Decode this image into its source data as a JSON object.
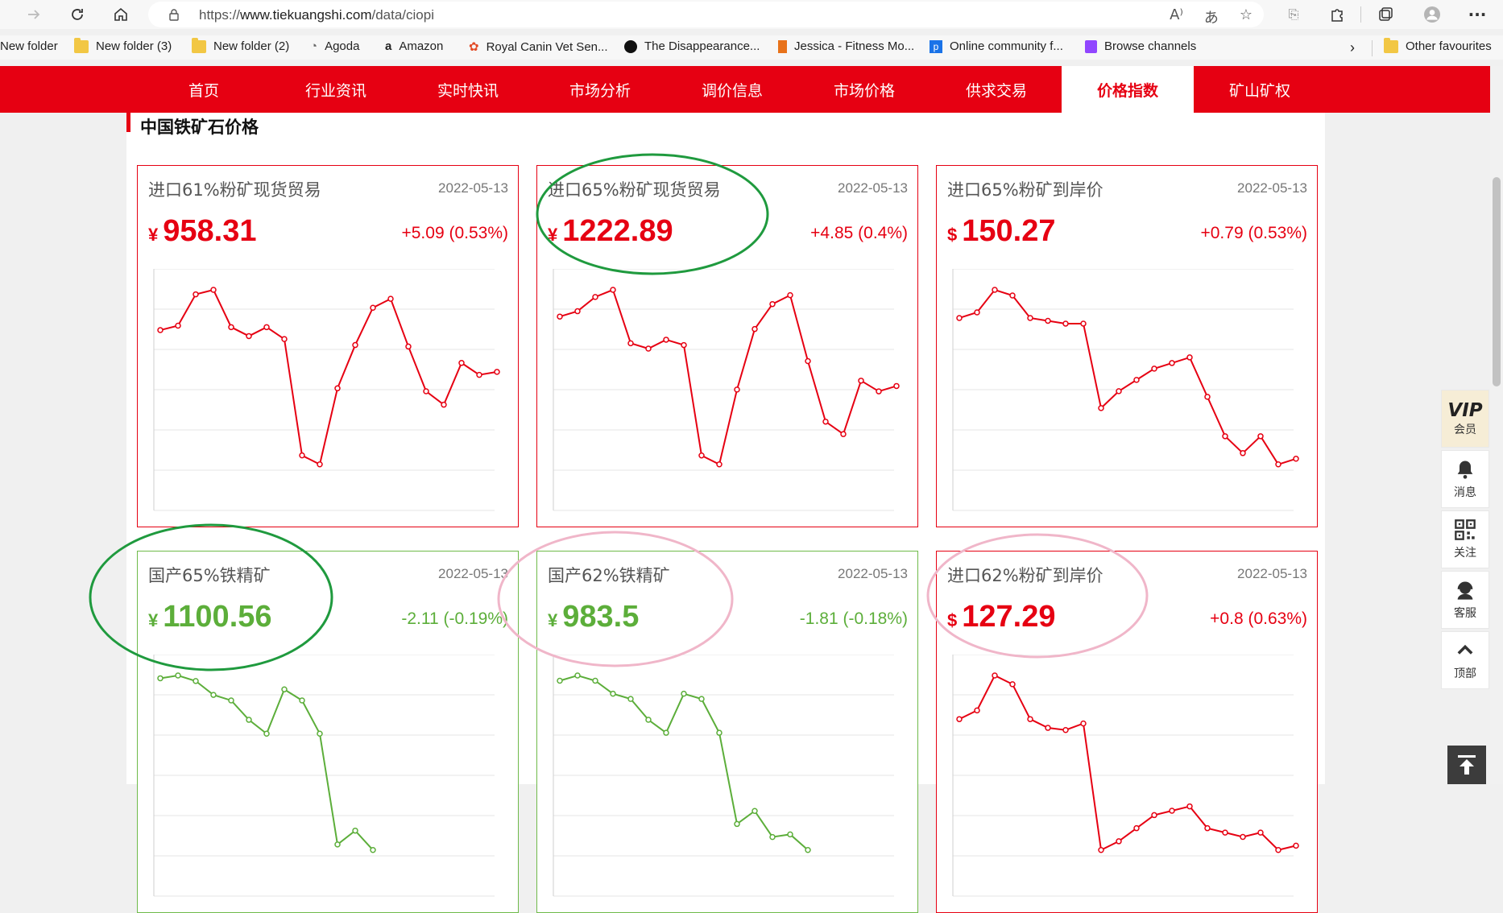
{
  "browser": {
    "url_prefix": "https://",
    "url_host": "www.tiekuangshi.com",
    "url_path": "/data/ciopi",
    "bookmarks": [
      {
        "label": "New folder",
        "icon": "folder-icon"
      },
      {
        "label": "New folder (3)",
        "icon": "folder-icon"
      },
      {
        "label": "New folder (2)",
        "icon": "folder-icon"
      },
      {
        "label": "Agoda",
        "icon": "agoda-icon"
      },
      {
        "label": "Amazon",
        "icon": "amazon-icon"
      },
      {
        "label": "Royal Canin Vet Sen...",
        "icon": "royal-canin-icon"
      },
      {
        "label": "The Disappearance...",
        "icon": "netflix-icon"
      },
      {
        "label": "Jessica - Fitness Mo...",
        "icon": "bookmark-icon"
      },
      {
        "label": "Online community f...",
        "icon": "community-icon"
      },
      {
        "label": "Browse channels",
        "icon": "twitch-icon"
      }
    ],
    "other_favourites": "Other favourites"
  },
  "nav": {
    "items": [
      "首页",
      "行业资讯",
      "实时快讯",
      "市场分析",
      "调价信息",
      "市场价格",
      "供求交易",
      "价格指数",
      "矿山矿权"
    ],
    "active_index": 7
  },
  "section_title": "中国铁矿石价格",
  "cards": [
    {
      "name": "进口61%粉矿现货贸易",
      "date": "2022-05-13",
      "currency": "¥",
      "price": "958.31",
      "change": "+5.09 (0.53%)",
      "trend": "up",
      "chart_data": {
        "type": "line",
        "values": [
          956,
          959,
          980,
          983,
          958,
          952,
          958,
          950,
          872,
          866,
          917,
          946,
          971,
          977,
          945,
          915,
          906,
          934,
          926,
          928
        ]
      }
    },
    {
      "name": "进口65%粉矿现货贸易",
      "date": "2022-05-13",
      "currency": "¥",
      "price": "1222.89",
      "change": "+4.85 (0.4%)",
      "trend": "up",
      "chart_data": {
        "type": "line",
        "values": [
          1223,
          1226,
          1234,
          1238,
          1208,
          1205,
          1210,
          1207,
          1145,
          1140,
          1182,
          1216,
          1230,
          1235,
          1198,
          1164,
          1157,
          1187,
          1181,
          1184
        ]
      }
    },
    {
      "name": "进口65%粉矿到岸价",
      "date": "2022-05-13",
      "currency": "$",
      "price": "150.27",
      "change": "+0.79 (0.53%)",
      "trend": "up",
      "chart_data": {
        "type": "line",
        "values": [
          162,
          163,
          167,
          166,
          162,
          161.5,
          161,
          161,
          146,
          149,
          151,
          153,
          154,
          155,
          148,
          141,
          138,
          141,
          136,
          137
        ]
      }
    },
    {
      "name": "国产65%铁精矿",
      "date": "2022-05-13",
      "currency": "¥",
      "price": "1100.56",
      "change": "-2.11 (-0.19%)",
      "trend": "down",
      "chart_data": {
        "type": "line",
        "values": [
          1160,
          1161,
          1159,
          1154,
          1152,
          1145,
          1140,
          1156,
          1152,
          1140,
          1100,
          1105,
          1098
        ]
      }
    },
    {
      "name": "国产62%铁精矿",
      "date": "2022-05-13",
      "currency": "¥",
      "price": "983.5",
      "change": "-1.81 (-0.18%)",
      "trend": "down",
      "chart_data": {
        "type": "line",
        "values": [
          1040,
          1042,
          1040,
          1035,
          1033,
          1025,
          1020,
          1035,
          1033,
          1020,
          985,
          990,
          980,
          981,
          975
        ]
      }
    },
    {
      "name": "进口62%粉矿到岸价",
      "date": "2022-05-13",
      "currency": "$",
      "price": "127.29",
      "change": "+0.8 (0.63%)",
      "trend": "up",
      "chart_data": {
        "type": "line",
        "values": [
          140,
          142,
          150,
          148,
          140,
          138,
          137.5,
          139,
          110,
          112,
          115,
          118,
          119,
          120,
          115,
          114,
          113,
          114,
          110,
          111
        ]
      }
    }
  ],
  "sidebar": {
    "vip_logo": "VIP",
    "vip_label": "会员",
    "message_label": "消息",
    "follow_label": "关注",
    "service_label": "客服",
    "top_label": "顶部"
  }
}
